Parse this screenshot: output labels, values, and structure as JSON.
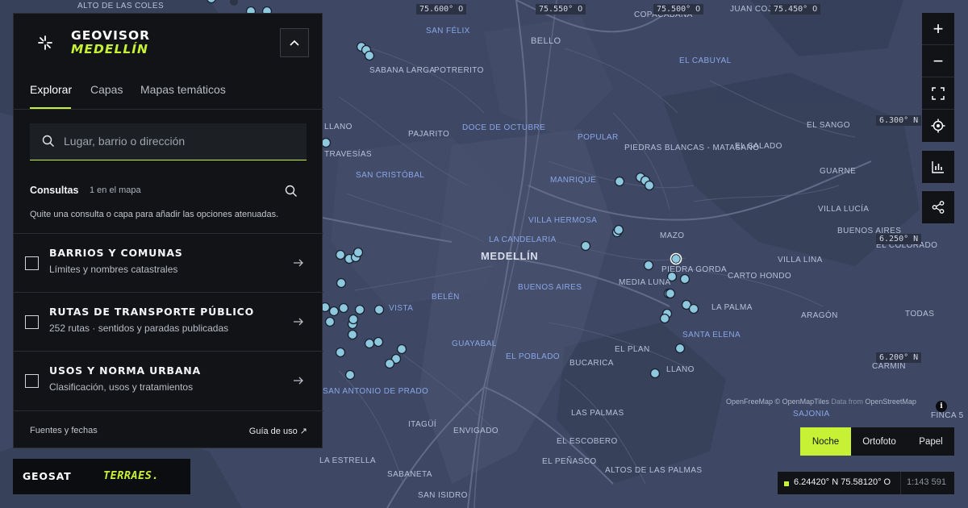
{
  "panel": {
    "brand_line1": "GEOVISOR",
    "brand_line2": "MEDELLÍN",
    "tabs": [
      {
        "label": "Explorar",
        "active": true
      },
      {
        "label": "Capas",
        "active": false
      },
      {
        "label": "Mapas temáticos",
        "active": false
      }
    ],
    "search_placeholder": "Lugar, barrio o dirección",
    "consultas_title": "Consultas",
    "consultas_count": "1 en el mapa",
    "consultas_hint": "Quite una consulta o capa para añadir las opciones atenuadas.",
    "layers": [
      {
        "title": "BARRIOS Y COMUNAS",
        "subtitle": "Límites y nombres catastrales",
        "checked": false
      },
      {
        "title": "RUTAS DE TRANSPORTE PÚBLICO",
        "subtitle": "252 rutas · sentidos y paradas publicadas",
        "checked": false
      },
      {
        "title": "USOS Y NORMA URBANA",
        "subtitle": "Clasificación, usos y tratamientos",
        "checked": false
      }
    ],
    "footer_sources": "Fuentes y fechas",
    "footer_guide": "Guía de uso ↗"
  },
  "logos": {
    "geosat": "GEOSAT",
    "terraes": "TERRAES."
  },
  "map": {
    "grid_labels": {
      "lon1": "75.600° O",
      "lon2": "75.550° O",
      "lon3": "75.500° O",
      "lon4": "75.450° O",
      "lat1": "6.300° N",
      "lat2": "6.250° N",
      "lat3": "6.200° N"
    },
    "places": {
      "alto_colES": "ALTO DE LAS COLES",
      "san_felix": "SAN FÉLIX",
      "bello": "BELLO",
      "copacabana": "COPACABANA",
      "juan_cojo": "JUAN COJO",
      "el_cabuyal": "EL CABUYAL",
      "sabana_larga": "SABANA LARGA",
      "potrerito": "POTRERITO",
      "llano": "LLANO",
      "pajarito": "PAJARITO",
      "doce_octubre": "DOCE DE OCTUBRE",
      "popular": "POPULAR",
      "el_sango": "EL SANGO",
      "travesias": "TRAVESÍAS",
      "piedras_blancas": "PIEDRAS BLANCAS - MATASANO",
      "el_salado": "EL SALADO",
      "san_cristobal": "SAN CRISTÓBAL",
      "manrique": "MANRIQUE",
      "guarne": "GUARNE",
      "villa_hermosa": "VILLA HERMOSA",
      "villa_lucia": "VILLA LUCÍA",
      "buenos_aires_n": "BUENOS AIRES",
      "la_candelaria": "LA CANDELARIA",
      "mazo": "MAZO",
      "el_colorado": "EL COLORADO",
      "medellin": "MEDELLÍN",
      "villa_lina": "VILLA LINA",
      "piedra_gorda": "PIEDRA GORDA",
      "media_luna": "MEDIA LUNA",
      "carto_hondo": "CARTO HONDO",
      "buenos_aires": "BUENOS AIRES",
      "la_palma": "LA PALMA",
      "belen": "BELÉN",
      "santa_elena": "SANTA ELENA",
      "aragon": "ARAGÓN",
      "todas": "TODAS",
      "guayabal": "GUAYABAL",
      "el_plan": "EL PLAN",
      "el_poblado": "EL POBLADO",
      "bucarica": "BUCARICA",
      "llano_e": "LLANO",
      "carmin": "CARMIN",
      "san_antonio": "SAN ANTONIO DE PRADO",
      "sajonia": "SAJONIA",
      "finca": "FINCA 5",
      "itagui": "ITAGÜÍ",
      "envigado": "ENVIGADO",
      "las_palmas": "LAS PALMAS",
      "el_escobero": "EL ESCOBERO",
      "la_estrella": "LA ESTRELLA",
      "el_penasco": "EL PEÑASCO",
      "altos_palmas": "ALTOS DE LAS PALMAS",
      "sabaneta": "SABANETA",
      "san_isidro": "SAN ISIDRO",
      "vista": "VISTA"
    },
    "attribution_main": "OpenFreeMap © OpenMapTiles",
    "attribution_dim": " Data from ",
    "attribution_osm": "OpenStreetMap"
  },
  "controls": {
    "zoom_in": "+",
    "zoom_out": "−"
  },
  "basemap": {
    "options": [
      {
        "label": "Noche",
        "active": true
      },
      {
        "label": "Ortofoto",
        "active": false
      },
      {
        "label": "Papel",
        "active": false
      }
    ]
  },
  "status": {
    "coordinates": "6.24420° N 75.58120° O",
    "scale": "1:143 591"
  },
  "colors": {
    "accent": "#c6f135",
    "panel_bg": "#111316",
    "map_bg": "#3e4864",
    "marker": "#8ec8df"
  }
}
